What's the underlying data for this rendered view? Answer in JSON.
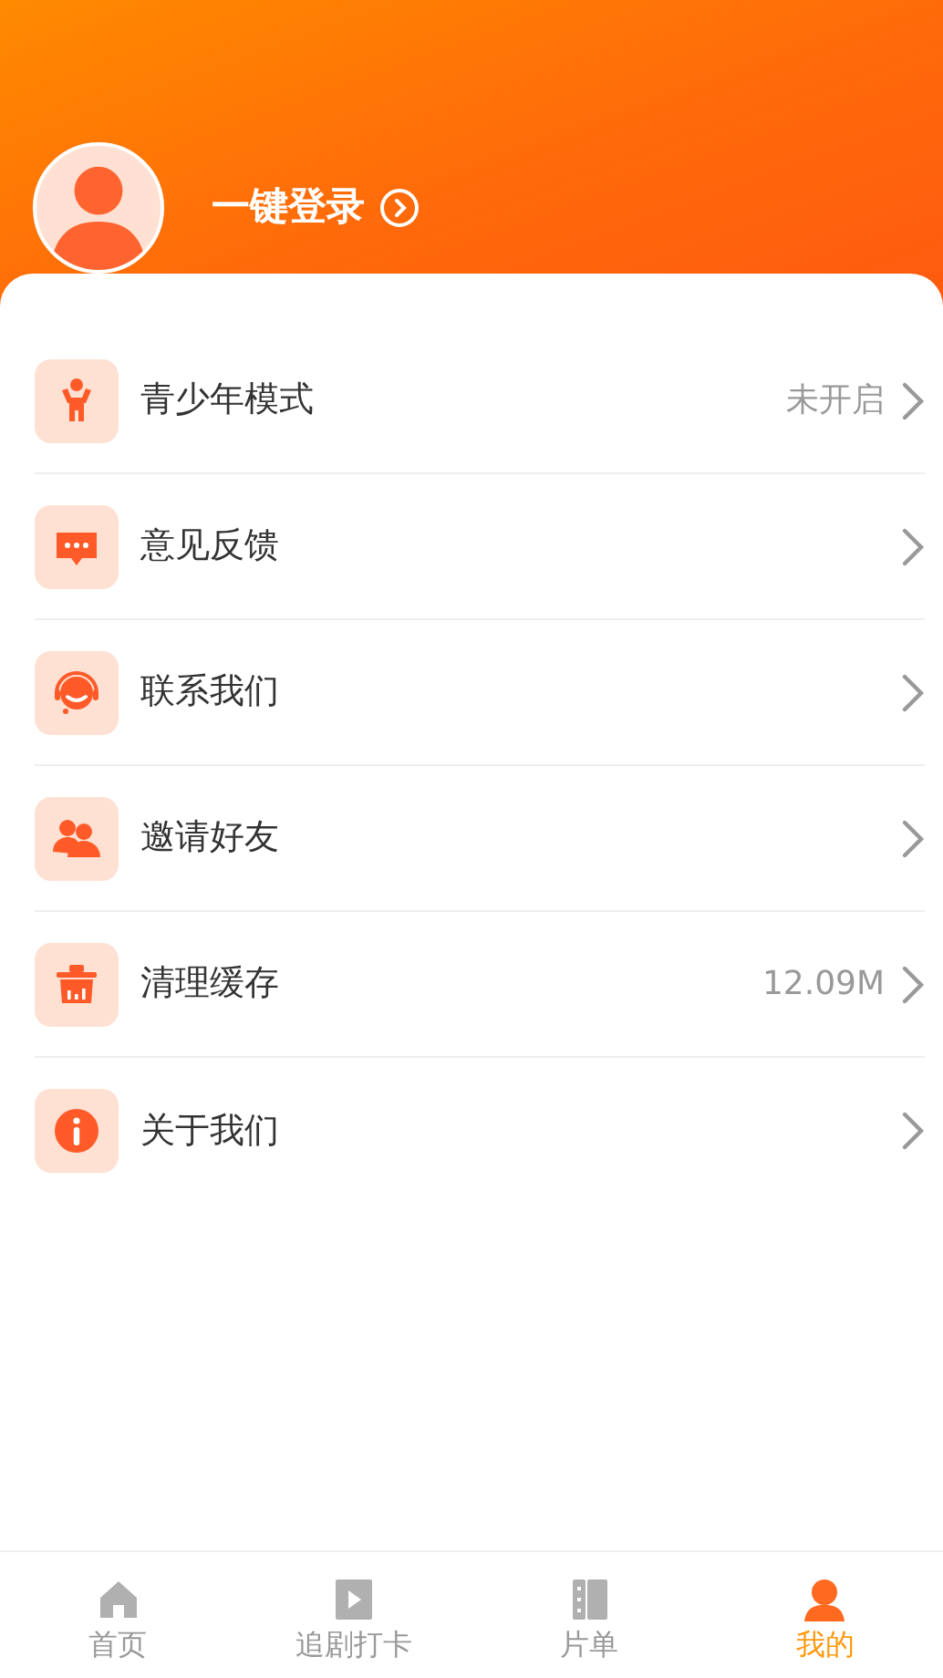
{
  "profile": {
    "login_label": "一键登录"
  },
  "menu": [
    {
      "kind": "teen",
      "label": "青少年模式",
      "value": "未开启"
    },
    {
      "kind": "feedback",
      "label": "意见反馈"
    },
    {
      "kind": "support",
      "label": "联系我们"
    },
    {
      "kind": "invite",
      "label": "邀请好友"
    },
    {
      "kind": "clean",
      "label": "清理缓存",
      "value": "12.09M"
    },
    {
      "kind": "about",
      "label": "关于我们"
    }
  ],
  "tab_bar": [
    {
      "kind": "home",
      "label": "首页",
      "selected": false
    },
    {
      "kind": "play",
      "label": "追剧打卡",
      "selected": false
    },
    {
      "kind": "list",
      "label": "片单",
      "selected": false
    },
    {
      "kind": "me",
      "label": "我的",
      "selected": true
    }
  ]
}
